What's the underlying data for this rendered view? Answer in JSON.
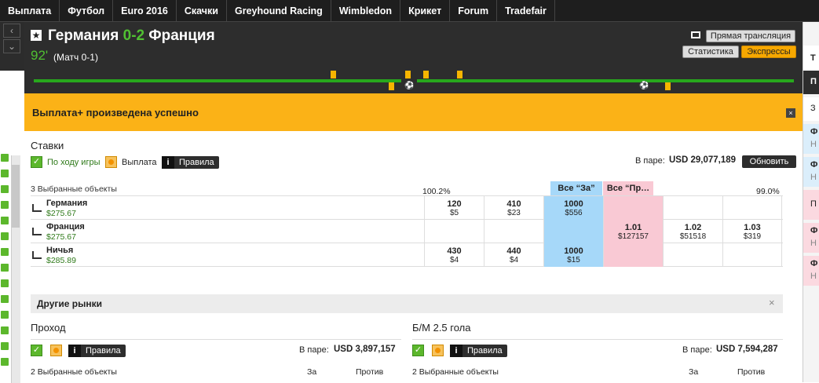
{
  "nav": {
    "items": [
      "Выплата",
      "Футбол",
      "Euro 2016",
      "Скачки",
      "Greyhound Racing",
      "Wimbledon",
      "Крикет",
      "Forum",
      "Tradefair"
    ]
  },
  "match": {
    "team_home": "Германия",
    "score": "0-2",
    "team_away": "Франция",
    "minute": "92'",
    "note": "(Матч 0-1)",
    "live_stream_label": "Прямая трансляция",
    "statistics_label": "Статистика",
    "accumulators_label": "Экспрессы"
  },
  "banner": {
    "text": "Выплата+ произведена успешно",
    "close": "×"
  },
  "bets": {
    "title": "Ставки",
    "in_play_label": "По ходу игры",
    "cashout_label": "Выплата",
    "rules_label": "Правила",
    "matched_label": "В паре:",
    "matched_value": "USD 29,077,189",
    "refresh_label": "Обновить",
    "selections_count": "3 Выбранные объекты",
    "book_back": "100.2%",
    "book_lay": "99.0%",
    "back_all_label": "Все “За”",
    "lay_all_label": "Все “Пр…",
    "runners": [
      {
        "name": "Германия",
        "pnl": "$275.67",
        "back": [
          {
            "p": "120",
            "s": "$5"
          },
          {
            "p": "410",
            "s": "$23"
          },
          {
            "p": "1000",
            "s": "$556"
          }
        ],
        "lay": [
          {
            "p": "",
            "s": ""
          },
          {
            "p": "",
            "s": ""
          },
          {
            "p": "",
            "s": ""
          }
        ]
      },
      {
        "name": "Франция",
        "pnl": "$275.67",
        "back": [
          {
            "p": "",
            "s": ""
          },
          {
            "p": "",
            "s": ""
          },
          {
            "p": "",
            "s": ""
          }
        ],
        "lay": [
          {
            "p": "1.01",
            "s": "$127157"
          },
          {
            "p": "1.02",
            "s": "$51518"
          },
          {
            "p": "1.03",
            "s": "$319"
          }
        ]
      },
      {
        "name": "Ничья",
        "pnl": "$285.89",
        "back": [
          {
            "p": "430",
            "s": "$4"
          },
          {
            "p": "440",
            "s": "$4"
          },
          {
            "p": "1000",
            "s": "$15"
          }
        ],
        "lay": [
          {
            "p": "",
            "s": ""
          },
          {
            "p": "",
            "s": ""
          },
          {
            "p": "",
            "s": ""
          }
        ]
      }
    ]
  },
  "other_markets": {
    "title": "Другие рынки",
    "close": "×",
    "markets": [
      {
        "title": "Проход",
        "rules_label": "Правила",
        "matched_label": "В паре:",
        "matched_value": "USD 3,897,157",
        "selections": "2 Выбранные объекты",
        "back_label": "За",
        "lay_label": "Против"
      },
      {
        "title": "Б/М 2.5 гола",
        "rules_label": "Правила",
        "matched_label": "В паре:",
        "matched_value": "USD 7,594,287",
        "selections": "2 Выбранные объекты",
        "back_label": "За",
        "lay_label": "Против"
      }
    ]
  },
  "right_panel": {
    "letters": [
      "T",
      "П",
      "З",
      "Ф",
      "Н",
      "Ф",
      "Н",
      "П",
      "Ф",
      "Н",
      "Ф",
      "Н"
    ]
  },
  "colors": {
    "accent": "#fbb217",
    "green": "#50c032",
    "back": "#a6d8f9",
    "lay": "#f9c9d4",
    "header_bg": "#2d2d2d"
  }
}
